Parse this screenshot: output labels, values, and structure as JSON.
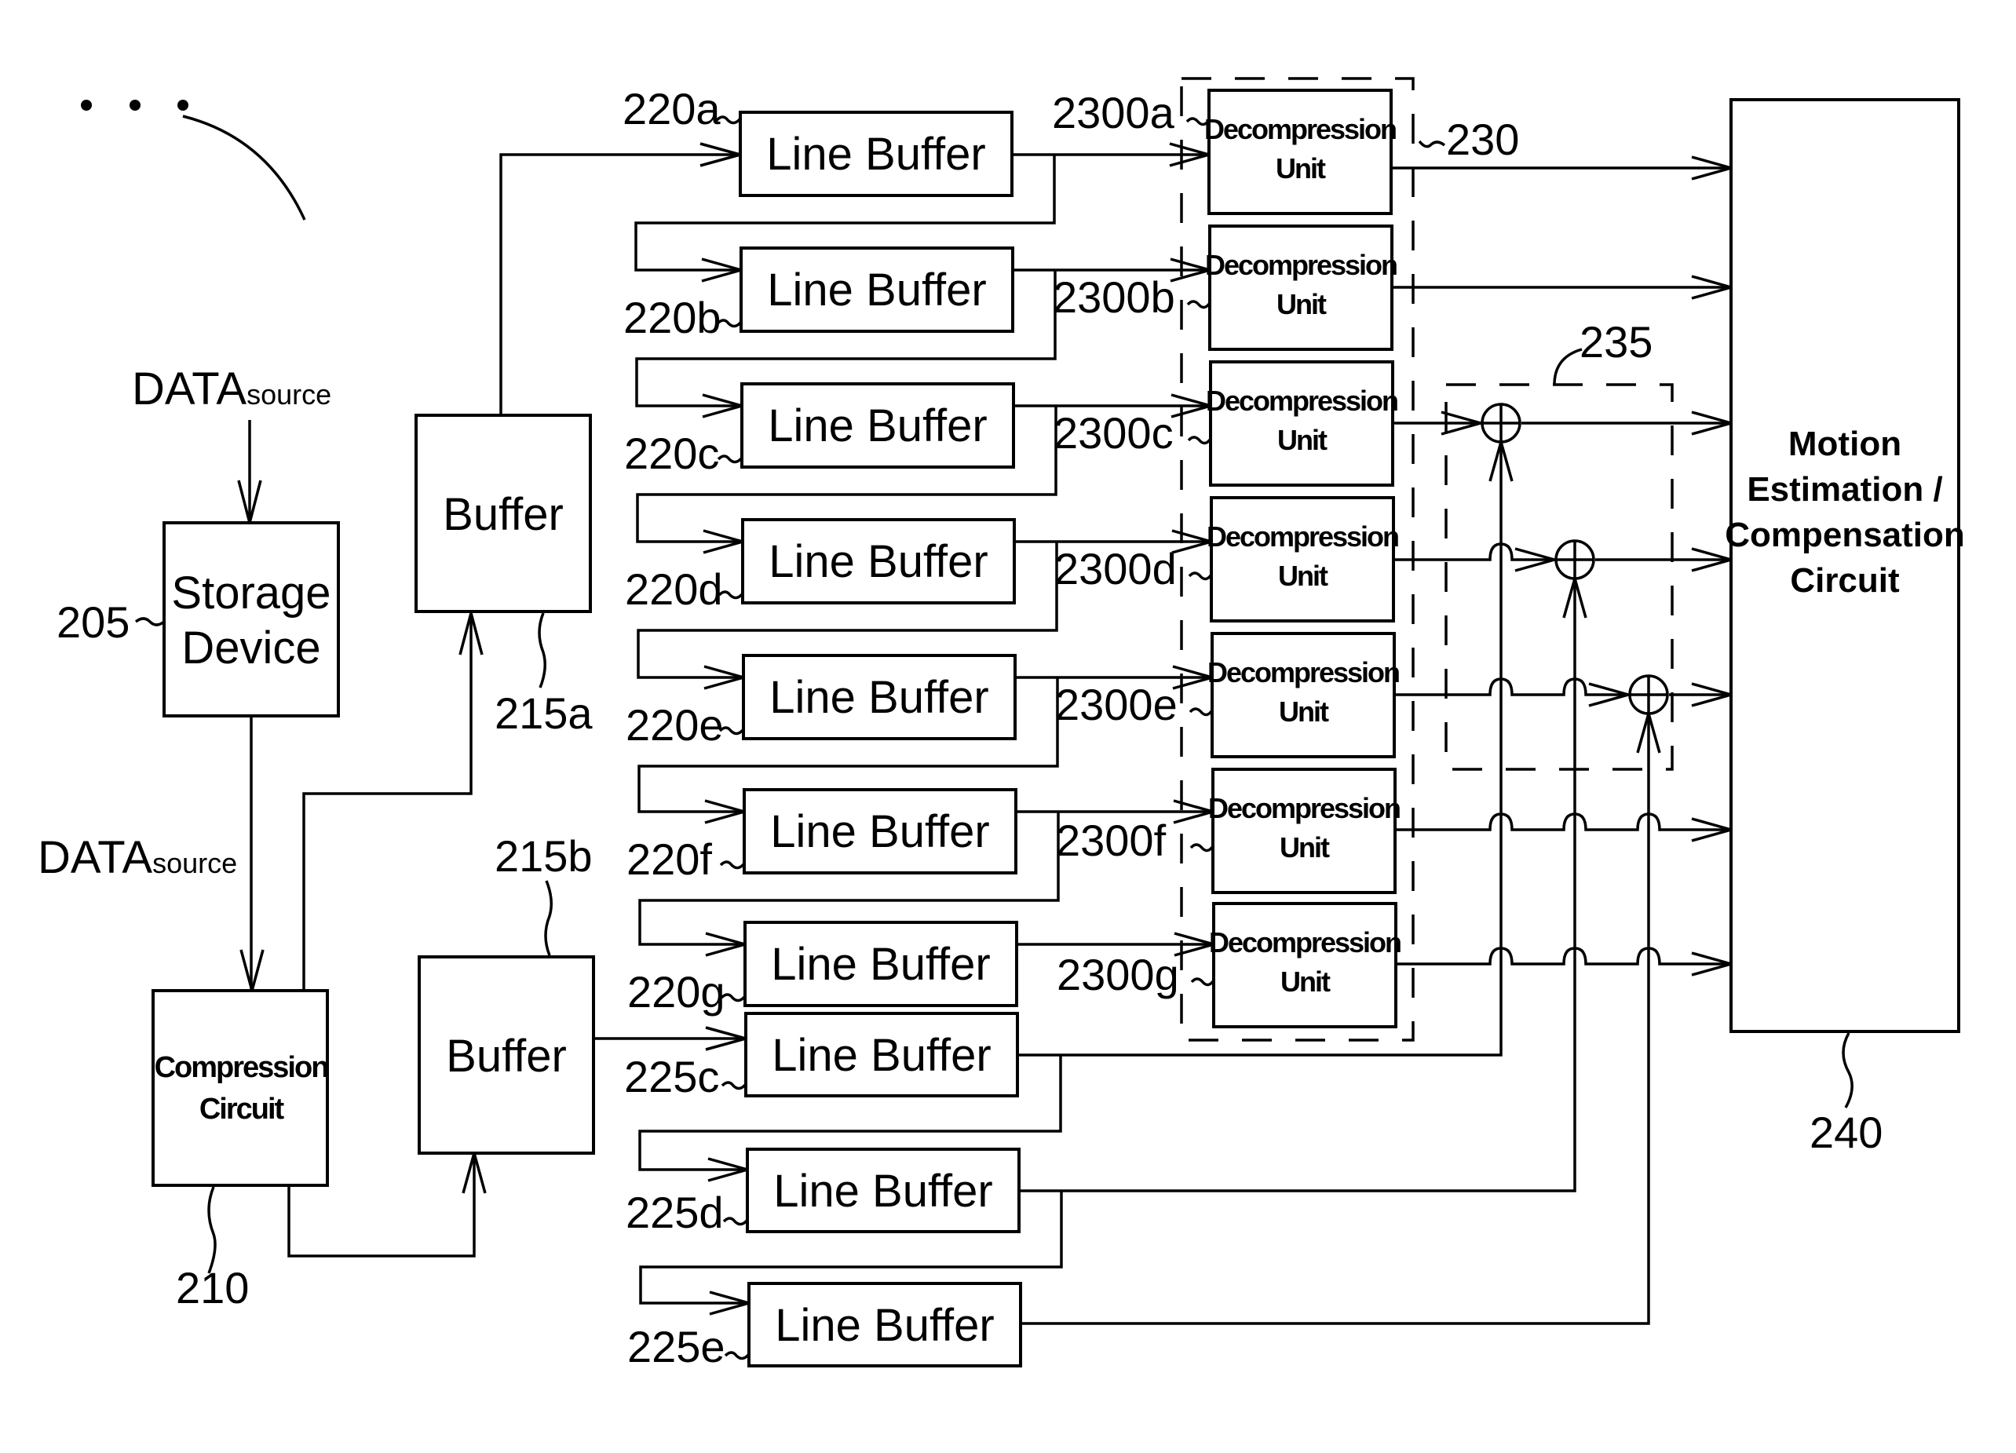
{
  "figure": {
    "ellipsis": "• • •",
    "data_source_main": "DATA",
    "data_source_sub": "source",
    "storage": {
      "ref": "205",
      "line1": "Storage",
      "line2": "Device"
    },
    "compression": {
      "ref": "210",
      "line1": "Compression",
      "line2": "Circuit"
    },
    "buffer_a": {
      "ref": "215a",
      "label": "Buffer"
    },
    "buffer_b": {
      "ref": "215b",
      "label": "Buffer"
    },
    "line_buffers": [
      {
        "ref": "220a",
        "label": "Line Buffer"
      },
      {
        "ref": "220b",
        "label": "Line Buffer"
      },
      {
        "ref": "220c",
        "label": "Line Buffer"
      },
      {
        "ref": "220d",
        "label": "Line Buffer"
      },
      {
        "ref": "220e",
        "label": "Line Buffer"
      },
      {
        "ref": "220f",
        "label": "Line Buffer"
      },
      {
        "ref": "220g",
        "label": "Line Buffer"
      }
    ],
    "extra_line_buffers": [
      {
        "ref": "225c",
        "label": "Line Buffer"
      },
      {
        "ref": "225d",
        "label": "Line Buffer"
      },
      {
        "ref": "225e",
        "label": "Line Buffer"
      }
    ],
    "decompression_group_ref": "230",
    "decompression_units": [
      {
        "ref": "2300a",
        "line1": "Decompression",
        "line2": "Unit"
      },
      {
        "ref": "2300b",
        "line1": "Decompression",
        "line2": "Unit"
      },
      {
        "ref": "2300c",
        "line1": "Decompression",
        "line2": "Unit"
      },
      {
        "ref": "2300d",
        "line1": "Decompression",
        "line2": "Unit"
      },
      {
        "ref": "2300e",
        "line1": "Decompression",
        "line2": "Unit"
      },
      {
        "ref": "2300f",
        "line1": "Decompression",
        "line2": "Unit"
      },
      {
        "ref": "2300g",
        "line1": "Decompression",
        "line2": "Unit"
      }
    ],
    "adder_group_ref": "235",
    "motion": {
      "ref": "240",
      "lines": [
        "Motion",
        "Estimation /",
        "Compensation",
        "Circuit"
      ]
    }
  }
}
